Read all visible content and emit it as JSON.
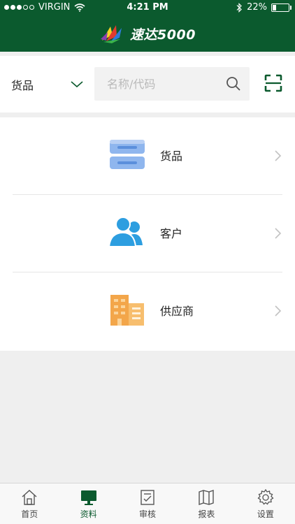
{
  "status_bar": {
    "carrier": "VIRGIN",
    "time": "4:21 PM",
    "battery": "22%",
    "battery_level": 0.22
  },
  "header": {
    "title": "速达5000"
  },
  "search": {
    "category": "货品",
    "placeholder": "名称/代码"
  },
  "menu": {
    "items": [
      {
        "label": "货品",
        "icon": "goods-icon",
        "color": "#7aa7e8"
      },
      {
        "label": "客户",
        "icon": "customers-icon",
        "color": "#2d9ee0"
      },
      {
        "label": "供应商",
        "icon": "supplier-building-icon",
        "color": "#f3a64a"
      }
    ]
  },
  "tabbar": {
    "active": "资料",
    "tabs": [
      {
        "label": "首页",
        "icon": "home-icon"
      },
      {
        "label": "资料",
        "icon": "monitor-icon"
      },
      {
        "label": "审核",
        "icon": "checklist-icon"
      },
      {
        "label": "报表",
        "icon": "map-icon"
      },
      {
        "label": "设置",
        "icon": "gear-icon"
      }
    ]
  },
  "colors": {
    "brand": "#0b5a2e",
    "background": "#efefef"
  }
}
